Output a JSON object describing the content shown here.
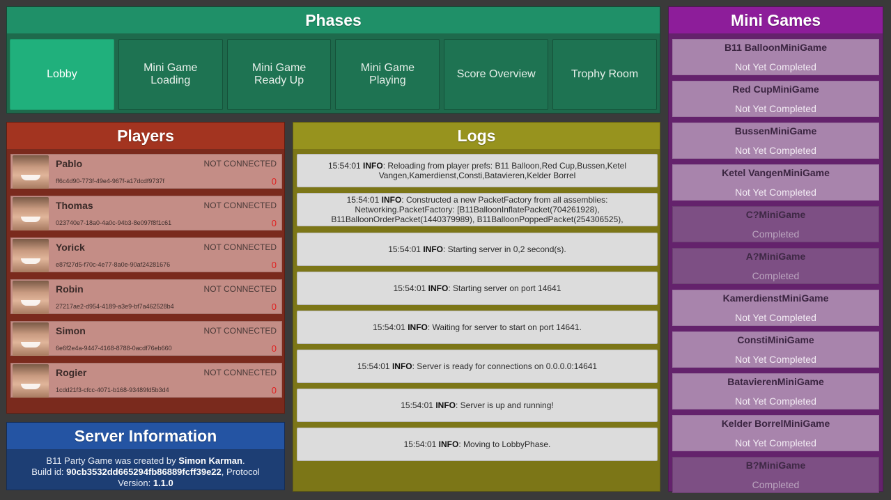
{
  "phases": {
    "title": "Phases",
    "buttons": [
      "Lobby",
      "Mini Game\nLoading",
      "Mini Game\nReady Up",
      "Mini Game\nPlaying",
      "Score Overview",
      "Trophy Room"
    ],
    "active_index": 0
  },
  "players": {
    "title": "Players",
    "list": [
      {
        "name": "Pablo",
        "status": "NOT CONNECTED",
        "id": "ff6c4d90-773f-49e4-967f-a17dcdf9737f",
        "score": "0"
      },
      {
        "name": "Thomas",
        "status": "NOT CONNECTED",
        "id": "023740e7-18a0-4a0c-94b3-8e097f8f1c61",
        "score": "0"
      },
      {
        "name": "Yorick",
        "status": "NOT CONNECTED",
        "id": "e87f27d5-f70c-4e77-8a0e-90af24281676",
        "score": "0"
      },
      {
        "name": "Robin",
        "status": "NOT CONNECTED",
        "id": "27217ae2-d954-4189-a3e9-bf7a462528b4",
        "score": "0"
      },
      {
        "name": "Simon",
        "status": "NOT CONNECTED",
        "id": "6e6f2e4a-9447-4168-8788-0acdf76eb660",
        "score": "0"
      },
      {
        "name": "Rogier",
        "status": "NOT CONNECTED",
        "id": "1cdd21f3-cfcc-4071-b168-93489fd5b3d4",
        "score": "0"
      }
    ]
  },
  "server": {
    "title": "Server Information",
    "line1_prefix": "B11 Party Game was created by ",
    "author": "Simon Karman",
    "line1_suffix": ".",
    "build_prefix": "Build id: ",
    "build_id": "90cb3532dd665294fb86889fcff39e22",
    "build_suffix": ", Protocol",
    "version_prefix": "Version: ",
    "version": "1.1.0"
  },
  "logs": {
    "title": "Logs",
    "entries": [
      {
        "time": "15:54:01",
        "level": "INFO",
        "message": ": Reloading from player prefs: B11 Balloon,Red Cup,Bussen,Ketel Vangen,Kamerdienst,Consti,Batavieren,Kelder Borrel"
      },
      {
        "time": "15:54:01",
        "level": "INFO",
        "message": ": Constructed a new PacketFactory from all assemblies: Networking.PacketFactory: [B11BalloonInflatePacket(704261928), B11BalloonOrderPacket(1440379989), B11BalloonPoppedPacket(254306525),"
      },
      {
        "time": "15:54:01",
        "level": "INFO",
        "message": ": Starting server in 0,2 second(s)."
      },
      {
        "time": "15:54:01",
        "level": "INFO",
        "message": ": Starting server on port 14641"
      },
      {
        "time": "15:54:01",
        "level": "INFO",
        "message": ": Waiting for server to start on port 14641."
      },
      {
        "time": "15:54:01",
        "level": "INFO",
        "message": ": Server is ready for connections on 0.0.0.0:14641"
      },
      {
        "time": "15:54:01",
        "level": "INFO",
        "message": ": Server is up and running!"
      },
      {
        "time": "15:54:01",
        "level": "INFO",
        "message": ": Moving to LobbyPhase."
      }
    ]
  },
  "minigames": {
    "title": "Mini Games",
    "list": [
      {
        "name": "B11 BalloonMiniGame",
        "status": "Not Yet Completed",
        "completed": false
      },
      {
        "name": "Red CupMiniGame",
        "status": "Not Yet Completed",
        "completed": false
      },
      {
        "name": "BussenMiniGame",
        "status": "Not Yet Completed",
        "completed": false
      },
      {
        "name": "Ketel VangenMiniGame",
        "status": "Not Yet Completed",
        "completed": false
      },
      {
        "name": "C?MiniGame",
        "status": "Completed",
        "completed": true
      },
      {
        "name": "A?MiniGame",
        "status": "Completed",
        "completed": true
      },
      {
        "name": "KamerdienstMiniGame",
        "status": "Not Yet Completed",
        "completed": false
      },
      {
        "name": "ConstiMiniGame",
        "status": "Not Yet Completed",
        "completed": false
      },
      {
        "name": "BatavierenMiniGame",
        "status": "Not Yet Completed",
        "completed": false
      },
      {
        "name": "Kelder BorrelMiniGame",
        "status": "Not Yet Completed",
        "completed": false
      },
      {
        "name": "B?MiniGame",
        "status": "Completed",
        "completed": true
      }
    ]
  },
  "colors": {
    "phases": "#1f9068",
    "players": "#a33420",
    "logs": "#97931e",
    "minigames": "#8d1d9a",
    "server": "#2454a3"
  }
}
